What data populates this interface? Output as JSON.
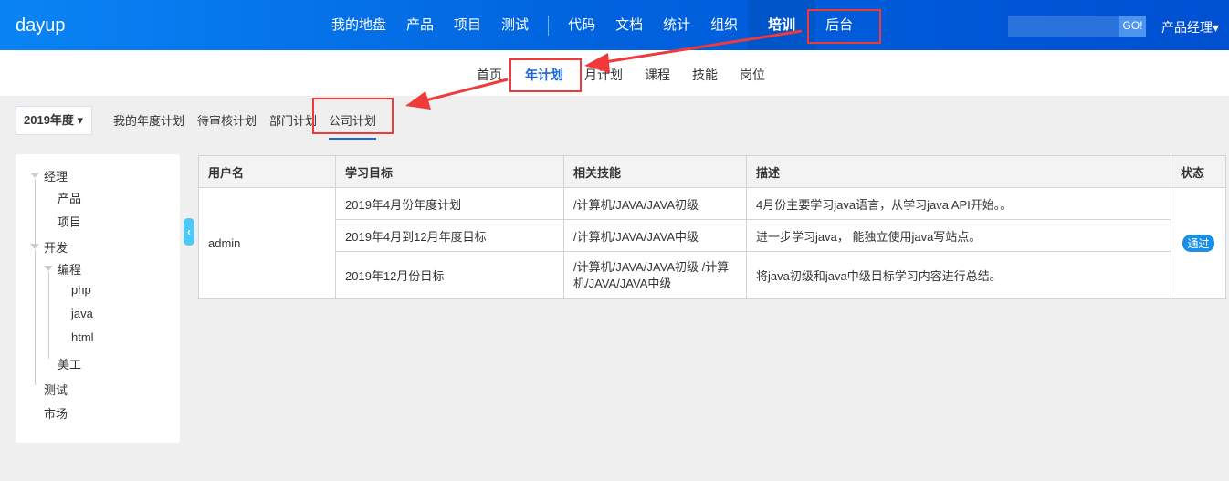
{
  "header": {
    "logo": "dayup",
    "nav": [
      "我的地盘",
      "产品",
      "项目",
      "测试",
      "代码",
      "文档",
      "统计",
      "组织",
      "培训",
      "后台"
    ],
    "active": "培训",
    "search_placeholder": "",
    "go": "GO!",
    "user": "产品经理▾"
  },
  "subnav": {
    "items": [
      "首页",
      "年计划",
      "月计划",
      "课程",
      "技能",
      "岗位"
    ],
    "active": "年计划"
  },
  "year_selector": "2019年度 ▾",
  "tabs": [
    "我的年度计划",
    "待审核计划",
    "部门计划",
    "公司计划"
  ],
  "tree": [
    "经理",
    "产品",
    "项目",
    "开发",
    "编程",
    "php",
    "java",
    "html",
    "美工",
    "测试",
    "市场"
  ],
  "table": {
    "headers": [
      "用户名",
      "学习目标",
      "相关技能",
      "描述",
      "状态"
    ],
    "user": "admin",
    "status": "通过",
    "rows": [
      {
        "goal": "2019年4月份年度计划",
        "skill": "/计算机/JAVA/JAVA初级",
        "desc": "4月份主要学习java语言，从学习java API开始。。"
      },
      {
        "goal": "2019年4月到12月年度目标",
        "skill": "/计算机/JAVA/JAVA中级",
        "desc": "进一步学习java， 能独立使用java写站点。"
      },
      {
        "goal": "2019年12月份目标",
        "skill": "/计算机/JAVA/JAVA初级 /计算机/JAVA/JAVA中级",
        "desc": "将java初级和java中级目标学习内容进行总结。"
      }
    ]
  },
  "colors": {
    "header": "#0062de",
    "accent": "#1a66d6",
    "annotation": "#f03a3a",
    "badge": "#1b8fe8"
  }
}
